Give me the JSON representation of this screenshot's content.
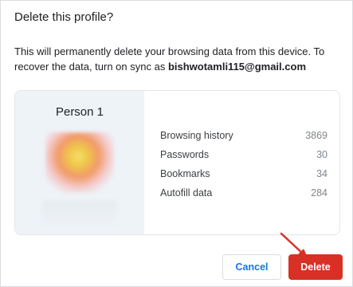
{
  "dialog": {
    "title": "Delete this profile?",
    "message_prefix": "This will permanently delete your browsing data from this device. To recover the data, turn on sync as ",
    "email": "bishwotamli115@gmail.com"
  },
  "profile": {
    "name": "Person 1",
    "stats": [
      {
        "label": "Browsing history",
        "value": "3869"
      },
      {
        "label": "Passwords",
        "value": "30"
      },
      {
        "label": "Bookmarks",
        "value": "34"
      },
      {
        "label": "Autofill data",
        "value": "284"
      }
    ]
  },
  "buttons": {
    "cancel": "Cancel",
    "delete": "Delete"
  },
  "colors": {
    "accent": "#1a73e8",
    "danger": "#d93025",
    "card_left_bg": "#eef3f8"
  },
  "annotation": {
    "arrow_icon": "red-arrow-icon"
  }
}
